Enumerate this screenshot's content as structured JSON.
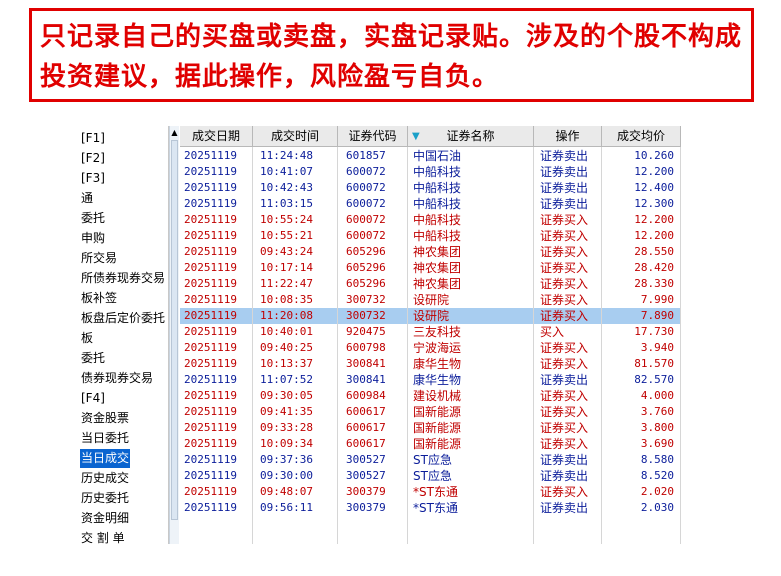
{
  "banner": {
    "text": "只记录自己的买盘或卖盘，实盘记录贴。涉及的个股不构成投资建议，据此操作，风险盈亏自负。"
  },
  "sidebar": {
    "items": [
      {
        "label": "[F1]"
      },
      {
        "label": "[F2]"
      },
      {
        "label": "[F3]"
      },
      {
        "label": "通"
      },
      {
        "label": "委托"
      },
      {
        "label": "申购"
      },
      {
        "label": "所交易"
      },
      {
        "label": "所债券现券交易"
      },
      {
        "label": "板补签"
      },
      {
        "label": "板盘后定价委托"
      },
      {
        "label": "板"
      },
      {
        "label": "委托"
      },
      {
        "label": "债券现券交易"
      },
      {
        "label": "[F4]"
      },
      {
        "label": "资金股票"
      },
      {
        "label": "当日委托"
      },
      {
        "label": "当日成交",
        "selected": true
      },
      {
        "label": "历史成交"
      },
      {
        "label": "历史委托"
      },
      {
        "label": "资金明细"
      },
      {
        "label": "交 割 单"
      }
    ]
  },
  "table": {
    "headers": [
      "成交日期",
      "成交时间",
      "证券代码",
      "证券名称",
      "操作",
      "成交均价"
    ],
    "colors": {
      "sell": "#0b1d9a",
      "buy": "#c00000",
      "selected_row": "#a8cdf0"
    },
    "rows": [
      {
        "date": "20251119",
        "time": "11:24:48",
        "code": "601857",
        "name": "中国石油",
        "op": "证券卖出",
        "price": "10.260",
        "side": "sell"
      },
      {
        "date": "20251119",
        "time": "10:41:07",
        "code": "600072",
        "name": "中船科技",
        "op": "证券卖出",
        "price": "12.200",
        "side": "sell"
      },
      {
        "date": "20251119",
        "time": "10:42:43",
        "code": "600072",
        "name": "中船科技",
        "op": "证券卖出",
        "price": "12.400",
        "side": "sell"
      },
      {
        "date": "20251119",
        "time": "11:03:15",
        "code": "600072",
        "name": "中船科技",
        "op": "证券卖出",
        "price": "12.300",
        "side": "sell"
      },
      {
        "date": "20251119",
        "time": "10:55:24",
        "code": "600072",
        "name": "中船科技",
        "op": "证券买入",
        "price": "12.200",
        "side": "buy"
      },
      {
        "date": "20251119",
        "time": "10:55:21",
        "code": "600072",
        "name": "中船科技",
        "op": "证券买入",
        "price": "12.200",
        "side": "buy"
      },
      {
        "date": "20251119",
        "time": "09:43:24",
        "code": "605296",
        "name": "神农集团",
        "op": "证券买入",
        "price": "28.550",
        "side": "buy"
      },
      {
        "date": "20251119",
        "time": "10:17:14",
        "code": "605296",
        "name": "神农集团",
        "op": "证券买入",
        "price": "28.420",
        "side": "buy"
      },
      {
        "date": "20251119",
        "time": "11:22:47",
        "code": "605296",
        "name": "神农集团",
        "op": "证券买入",
        "price": "28.330",
        "side": "buy"
      },
      {
        "date": "20251119",
        "time": "10:08:35",
        "code": "300732",
        "name": "设研院",
        "op": "证券买入",
        "price": "7.990",
        "side": "buy"
      },
      {
        "date": "20251119",
        "time": "11:20:08",
        "code": "300732",
        "name": "设研院",
        "op": "证券买入",
        "price": "7.890",
        "side": "buy",
        "selected": true
      },
      {
        "date": "20251119",
        "time": "10:40:01",
        "code": "920475",
        "name": "三友科技",
        "op": "买入",
        "price": "17.730",
        "side": "buy"
      },
      {
        "date": "20251119",
        "time": "09:40:25",
        "code": "600798",
        "name": "宁波海运",
        "op": "证券买入",
        "price": "3.940",
        "side": "buy"
      },
      {
        "date": "20251119",
        "time": "10:13:37",
        "code": "300841",
        "name": "康华生物",
        "op": "证券买入",
        "price": "81.570",
        "side": "buy"
      },
      {
        "date": "20251119",
        "time": "11:07:52",
        "code": "300841",
        "name": "康华生物",
        "op": "证券卖出",
        "price": "82.570",
        "side": "sell"
      },
      {
        "date": "20251119",
        "time": "09:30:05",
        "code": "600984",
        "name": "建设机械",
        "op": "证券买入",
        "price": "4.000",
        "side": "buy"
      },
      {
        "date": "20251119",
        "time": "09:41:35",
        "code": "600617",
        "name": "国新能源",
        "op": "证券买入",
        "price": "3.760",
        "side": "buy"
      },
      {
        "date": "20251119",
        "time": "09:33:28",
        "code": "600617",
        "name": "国新能源",
        "op": "证券买入",
        "price": "3.800",
        "side": "buy"
      },
      {
        "date": "20251119",
        "time": "10:09:34",
        "code": "600617",
        "name": "国新能源",
        "op": "证券买入",
        "price": "3.690",
        "side": "buy"
      },
      {
        "date": "20251119",
        "time": "09:37:36",
        "code": "300527",
        "name": "ST应急",
        "op": "证券卖出",
        "price": "8.580",
        "side": "sell"
      },
      {
        "date": "20251119",
        "time": "09:30:00",
        "code": "300527",
        "name": "ST应急",
        "op": "证券卖出",
        "price": "8.520",
        "side": "sell"
      },
      {
        "date": "20251119",
        "time": "09:48:07",
        "code": "300379",
        "name": "*ST东通",
        "op": "证券买入",
        "price": "2.020",
        "side": "buy"
      },
      {
        "date": "20251119",
        "time": "09:56:11",
        "code": "300379",
        "name": "*ST东通",
        "op": "证券卖出",
        "price": "2.030",
        "side": "sell"
      }
    ]
  }
}
